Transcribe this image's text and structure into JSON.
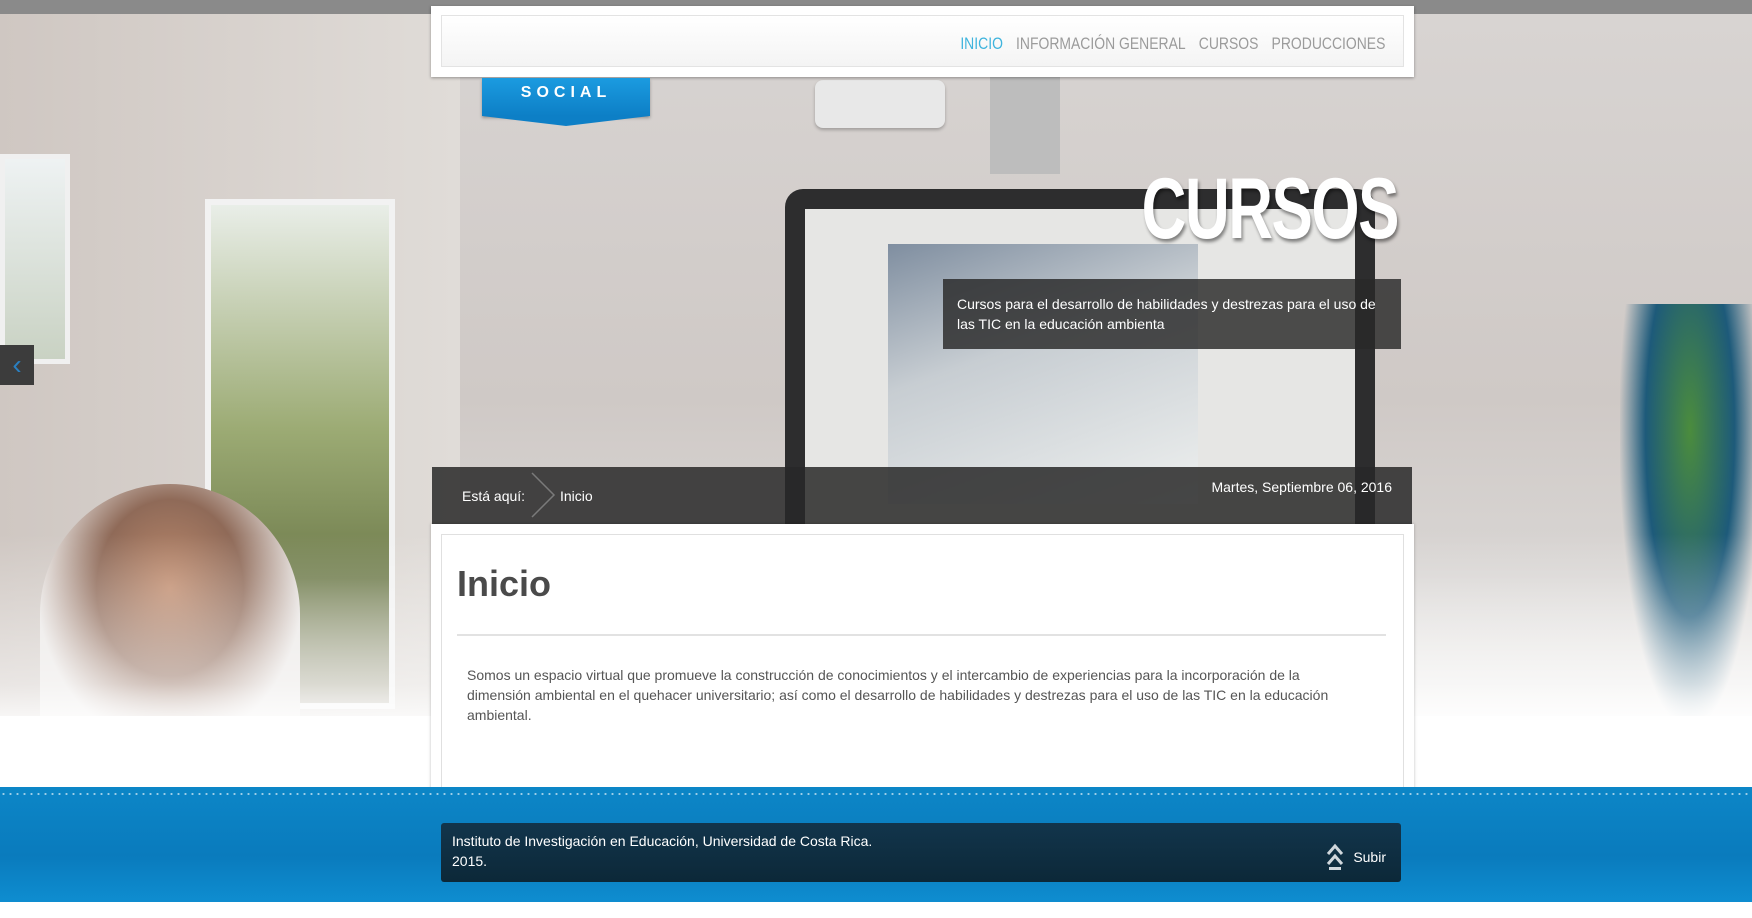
{
  "nav": {
    "items": [
      {
        "label": "INICIO",
        "active": true
      },
      {
        "label": "INFORMACIÓN GENERAL",
        "active": false
      },
      {
        "label": "CURSOS",
        "active": false
      },
      {
        "label": "PRODUCCIONES",
        "active": false
      }
    ]
  },
  "ribbon": {
    "label": "SOCIAL"
  },
  "slider": {
    "title": "CURSOS",
    "caption": "Cursos para el desarrollo de habilidades y destrezas para el uso de las TIC en la educación ambienta",
    "prev_icon": "chevron-left-icon"
  },
  "breadcrumb": {
    "label": "Está aquí:",
    "current": "Inicio",
    "date": "Martes, Septiembre 06, 2016"
  },
  "content": {
    "title": "Inicio",
    "body": "Somos un espacio virtual que promueve la construcción de conocimientos y el intercambio de experiencias para la incorporación de la dimensión ambiental en el quehacer universitario; así como el desarrollo de habilidades y destrezas para el uso de las TIC en la educación ambiental."
  },
  "footer": {
    "line1": "Instituto de Investigación en Educación, Universidad de Costa Rica.",
    "line2": "2015.",
    "up_label": "Subir",
    "up_icon": "double-chevron-up-icon"
  },
  "colors": {
    "accent": "#3fb4dd",
    "nav_text": "#9b9b9b",
    "ribbon": "#1b9be0",
    "footer_bg": "#0c86c7",
    "footer_box": "#12354c"
  }
}
